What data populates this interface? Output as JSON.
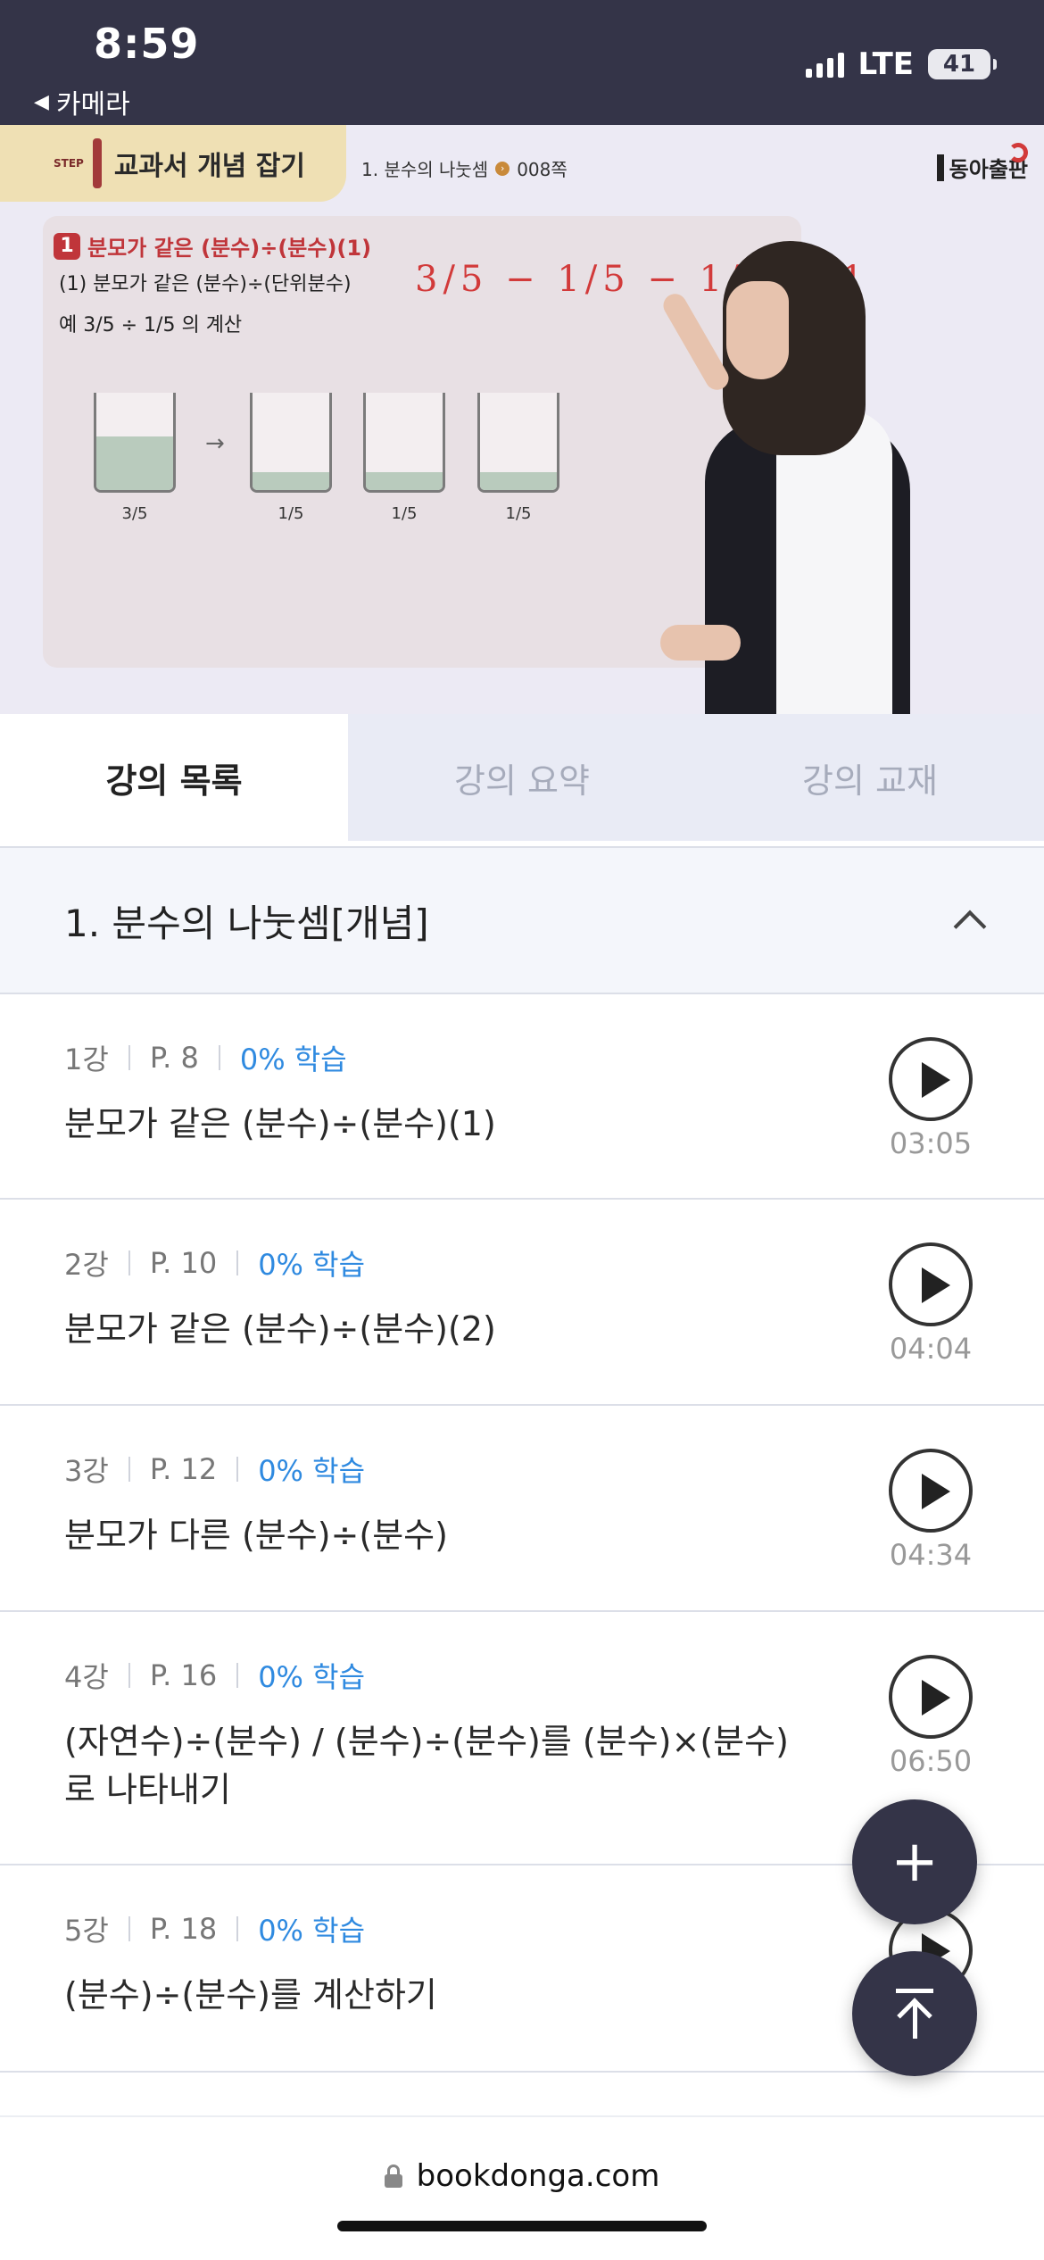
{
  "status_bar": {
    "time": "8:59",
    "back_app": "카메라",
    "network": "LTE",
    "battery": "41"
  },
  "video": {
    "step_label": "STEP",
    "step_title": "교과서 개념 잡기",
    "chapter_ref": "1. 분수의 나눗셈",
    "page_ref": "008쪽",
    "publisher": "동아출판",
    "concept_number": "1",
    "concept_title": "분모가 같은 (분수)÷(분수)(1)",
    "concept_sub": "(1) 분모가 같은 (분수)÷(단위분수)",
    "concept_example": "예 3/5 ÷ 1/5 의 계산",
    "beaker_labels": [
      "3/5",
      "1/5",
      "1/5",
      "1/5"
    ],
    "handwriting": "3/5 − 1/5 − 1/5 − 1"
  },
  "tabs": [
    {
      "label": "강의 목록",
      "active": true
    },
    {
      "label": "강의 요약",
      "active": false
    },
    {
      "label": "강의 교재",
      "active": false
    }
  ],
  "section": {
    "title": "1. 분수의 나눗셈[개념]"
  },
  "lectures": [
    {
      "num": "1강",
      "page": "P. 8",
      "progress": "0% 학습",
      "title": "분모가 같은 (분수)÷(분수)(1)",
      "duration": "03:05"
    },
    {
      "num": "2강",
      "page": "P. 10",
      "progress": "0% 학습",
      "title": "분모가 같은 (분수)÷(분수)(2)",
      "duration": "04:04"
    },
    {
      "num": "3강",
      "page": "P. 12",
      "progress": "0% 학습",
      "title": "분모가 다른 (분수)÷(분수)",
      "duration": "04:34"
    },
    {
      "num": "4강",
      "page": "P. 16",
      "progress": "0% 학습",
      "title": "(자연수)÷(분수) / (분수)÷(분수)를 (분수)×(분수)로 나타내기",
      "duration": "06:50"
    },
    {
      "num": "5강",
      "page": "P. 18",
      "progress": "0% 학습",
      "title": "(분수)÷(분수)를 계산하기",
      "duration": ""
    }
  ],
  "fab": {
    "plus_label": "+"
  },
  "url_bar": {
    "domain": "bookdonga.com"
  }
}
